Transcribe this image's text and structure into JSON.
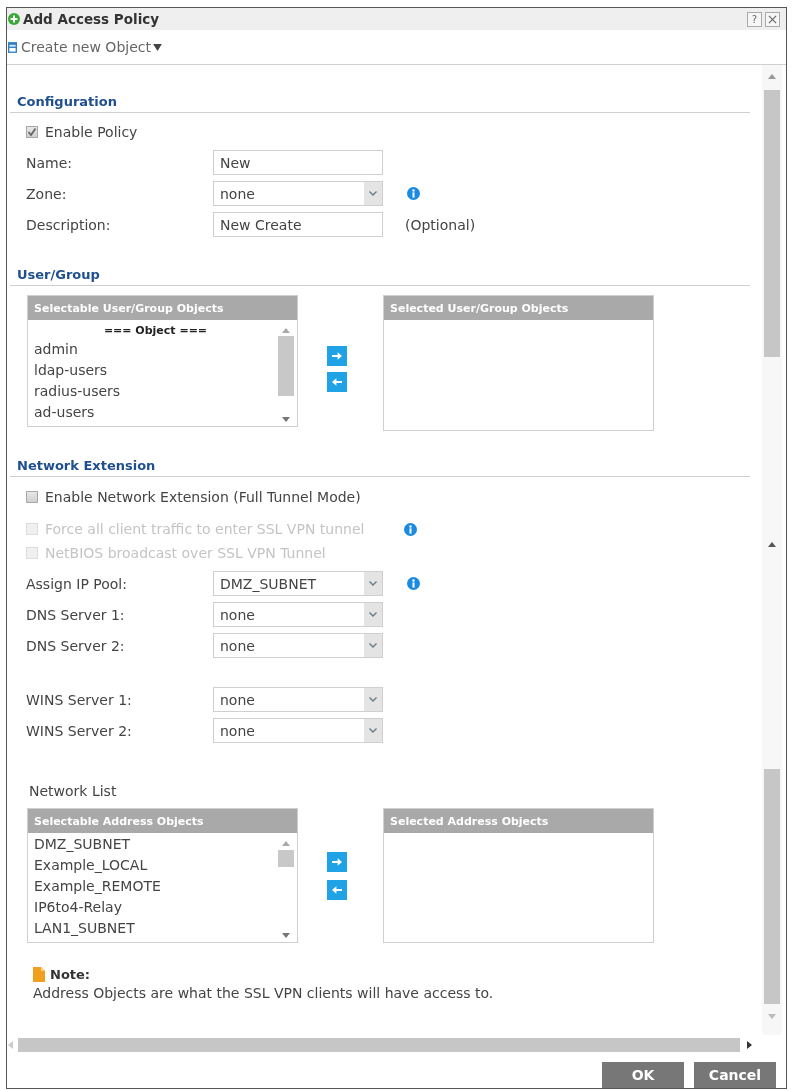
{
  "window": {
    "title": "Add Access Policy",
    "help": "?"
  },
  "toolbar": {
    "menu": "Create new Object"
  },
  "configuration": {
    "title": "Configuration",
    "enable_policy": {
      "label": "Enable Policy",
      "checked": true
    },
    "fields": [
      {
        "kind": "text",
        "label": "Name:",
        "value": "New",
        "info": false
      },
      {
        "kind": "select",
        "label": "Zone:",
        "value": "none",
        "info": true
      },
      {
        "kind": "text",
        "label": "Description:",
        "value": "New Create",
        "info": false,
        "suffix": "(Optional)"
      }
    ]
  },
  "user_group": {
    "title": "User/Group",
    "selectable": {
      "header": "Selectable User/Group Objects",
      "items": [
        {
          "kind": "heading",
          "text": "=== Object ==="
        },
        {
          "kind": "item",
          "text": "admin"
        },
        {
          "kind": "item",
          "text": "ldap-users"
        },
        {
          "kind": "item",
          "text": "radius-users"
        },
        {
          "kind": "item",
          "text": "ad-users"
        }
      ]
    },
    "selected": {
      "header": "Selected User/Group Objects"
    }
  },
  "network_extension": {
    "title": "Network Extension",
    "options": [
      {
        "label": "Enable Network Extension (Full Tunnel Mode)",
        "checked": false,
        "disabled": false,
        "info": false
      },
      {
        "label": "Force all client traffic to enter SSL VPN tunnel",
        "checked": false,
        "disabled": true,
        "info": true
      },
      {
        "label": "NetBIOS broadcast over SSL VPN Tunnel",
        "checked": false,
        "disabled": true,
        "info": false
      }
    ],
    "field_groups": [
      [
        {
          "kind": "select",
          "label": "Assign IP Pool:",
          "value": "DMZ_SUBNET",
          "info": true
        },
        {
          "kind": "select",
          "label": "DNS Server 1:",
          "value": "none",
          "info": false
        },
        {
          "kind": "select",
          "label": "DNS Server 2:",
          "value": "none",
          "info": false
        }
      ],
      [
        {
          "kind": "select",
          "label": "WINS Server 1:",
          "value": "none",
          "info": false
        },
        {
          "kind": "select",
          "label": "WINS Server 2:",
          "value": "none",
          "info": false
        }
      ]
    ]
  },
  "network_list": {
    "title": "Network List",
    "selectable": {
      "header": "Selectable Address Objects",
      "items": [
        {
          "kind": "item",
          "text": "DMZ_SUBNET"
        },
        {
          "kind": "item",
          "text": "Example_LOCAL"
        },
        {
          "kind": "item",
          "text": "Example_REMOTE"
        },
        {
          "kind": "item",
          "text": "IP6to4-Relay"
        },
        {
          "kind": "item",
          "text": "LAN1_SUBNET"
        }
      ]
    },
    "selected": {
      "header": "Selected Address Objects"
    }
  },
  "note": {
    "title": "Note:",
    "text": "Address Objects are what the SSL VPN clients will have access to."
  },
  "buttons": [
    "OK",
    "Cancel"
  ]
}
